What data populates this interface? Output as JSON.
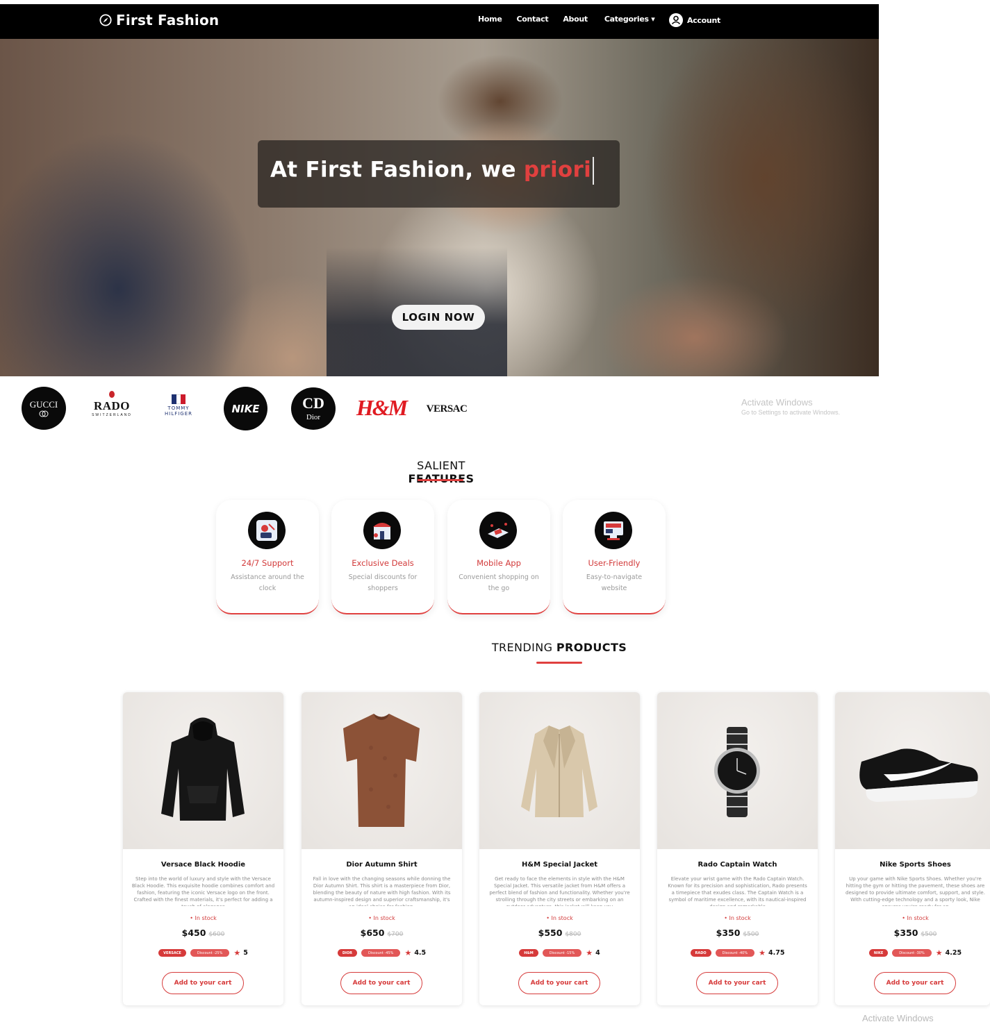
{
  "brand": {
    "name": "First Fashion",
    "logo_icon": "compass-icon"
  },
  "nav": {
    "links": [
      "Home",
      "Contact",
      "About",
      "Categories ▾"
    ],
    "account_label": "Account",
    "account_icon": "user-icon"
  },
  "hero": {
    "typing_prefix": "At First Fashion, we ",
    "typing_accent": "priori",
    "login_label": "LOGIN NOW"
  },
  "brands": {
    "gucci": "GUCCI",
    "rado": "RADO",
    "rado_sub": "SWITZERLAND",
    "tommy": "TOMMY",
    "tommy_sub": "HILFIGER",
    "nike": "NIKE",
    "dior_mark": "CD",
    "dior": "Dior",
    "hm": "H&M",
    "versace": "VERSAC"
  },
  "watermark": {
    "title": "Activate Windows",
    "subtitle": "Go to Settings to activate Windows.",
    "bottom": "Activate Windows"
  },
  "features_heading": {
    "light": "SALIENT ",
    "bold": "FEATURES"
  },
  "features": [
    {
      "title": "24/7 Support",
      "desc": "Assistance around the clock",
      "icon": "support-agent-icon"
    },
    {
      "title": "Exclusive Deals",
      "desc": "Special discounts for shoppers",
      "icon": "deals-store-icon"
    },
    {
      "title": "Mobile App",
      "desc": "Convenient shopping on the go",
      "icon": "mobile-app-icon"
    },
    {
      "title": "User-Friendly",
      "desc": "Easy-to-navigate website",
      "icon": "website-icon"
    }
  ],
  "products_heading": {
    "light": "TRENDING ",
    "bold": "PRODUCTS"
  },
  "products": [
    {
      "name": "Versace Black Hoodie",
      "desc": "Step into the world of luxury and style with the Versace Black Hoodie. This exquisite hoodie combines comfort and fashion, featuring the iconic Versace logo on the front. Crafted with the finest materials, it's perfect for adding a touch of elegance",
      "stock": "• In stock",
      "price": "$450",
      "old_price": "$600",
      "brand_tag": "VERSACE",
      "discount": "Discount -25%",
      "rating": "5",
      "cart_label": "Add to your cart",
      "image_icon": "hoodie-icon"
    },
    {
      "name": "Dior Autumn Shirt",
      "desc": "Fall in love with the changing seasons while donning the Dior Autumn Shirt. This shirt is a masterpiece from Dior, blending the beauty of nature with high fashion. With its autumn-inspired design and superior craftsmanship, it's an ideal choice for fashion-",
      "stock": "• In stock",
      "price": "$650",
      "old_price": "$700",
      "brand_tag": "DIOR",
      "discount": "Discount -45%",
      "rating": "4.5",
      "cart_label": "Add to your cart",
      "image_icon": "shirt-icon"
    },
    {
      "name": "H&M Special Jacket",
      "desc": "Get ready to face the elements in style with the H&M Special Jacket. This versatile jacket from H&M offers a perfect blend of fashion and functionality. Whether you're strolling through the city streets or embarking on an outdoor adventure, this jacket will keep you",
      "stock": "• In stock",
      "price": "$550",
      "old_price": "$800",
      "brand_tag": "H&M",
      "discount": "Discount -15%",
      "rating": "4",
      "cart_label": "Add to your cart",
      "image_icon": "jacket-icon"
    },
    {
      "name": "Rado Captain Watch",
      "desc": "Elevate your wrist game with the Rado Captain Watch. Known for its precision and sophistication, Rado presents a timepiece that exudes class. The Captain Watch is a symbol of maritime excellence, with its nautical-inspired design and remarkable",
      "stock": "• In stock",
      "price": "$350",
      "old_price": "$500",
      "brand_tag": "RADO",
      "discount": "Discount -40%",
      "rating": "4.75",
      "cart_label": "Add to your cart",
      "image_icon": "watch-icon"
    },
    {
      "name": "Nike Sports Shoes",
      "desc": "Up your game with Nike Sports Shoes. Whether you're hitting the gym or hitting the pavement, these shoes are designed to provide ultimate comfort, support, and style. With cutting-edge technology and a sporty look, Nike ensures you're ready for an",
      "stock": "• In stock",
      "price": "$350",
      "old_price": "$500",
      "brand_tag": "NIKE",
      "discount": "Discount -30%",
      "rating": "4.25",
      "cart_label": "Add to your cart",
      "image_icon": "sneaker-icon"
    }
  ],
  "colors": {
    "accent": "#e0403f",
    "nav_bg": "#000000"
  }
}
